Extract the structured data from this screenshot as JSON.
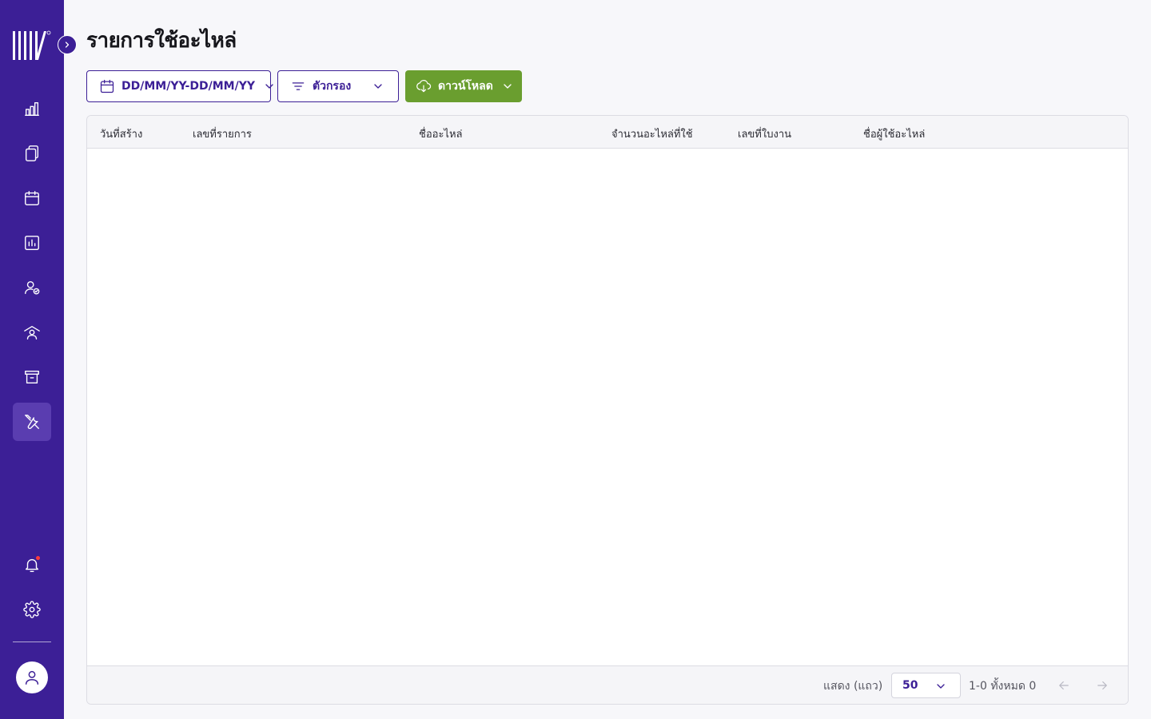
{
  "page": {
    "title": "รายการใช้อะไหล่"
  },
  "toolbar": {
    "date_range_label": "DD/MM/YY-DD/MM/YY",
    "filter_label": "ตัวกรอง",
    "download_label": "ดาวน์โหลด"
  },
  "table": {
    "columns": [
      "วันที่สร้าง",
      "เลขที่รายการ",
      "ชื่ออะไหล่",
      "จำนวนอะไหล่ที่ใช้",
      "เลขที่ใบงาน",
      "ชื่อผู้ใช้อะไหล่"
    ],
    "rows": []
  },
  "pagination": {
    "rows_label": "แสดง (แถว)",
    "rows_per_page": "50",
    "range_text": "1-0 ทั้งหมด 0"
  },
  "sidebar": {
    "items": [
      "dashboard-icon",
      "documents-icon",
      "calendar-icon",
      "report-icon",
      "user-check-icon",
      "technician-icon",
      "archive-icon",
      "tools-icon"
    ],
    "active_item": "tools-icon",
    "bottom": [
      "bell-icon",
      "gear-icon",
      "user-icon"
    ]
  },
  "colors": {
    "sidebar_bg": "#3c1f96",
    "accent": "#3c1f96",
    "download_bg": "#6a9e2f",
    "notification_dot": "#ff3b3b"
  }
}
